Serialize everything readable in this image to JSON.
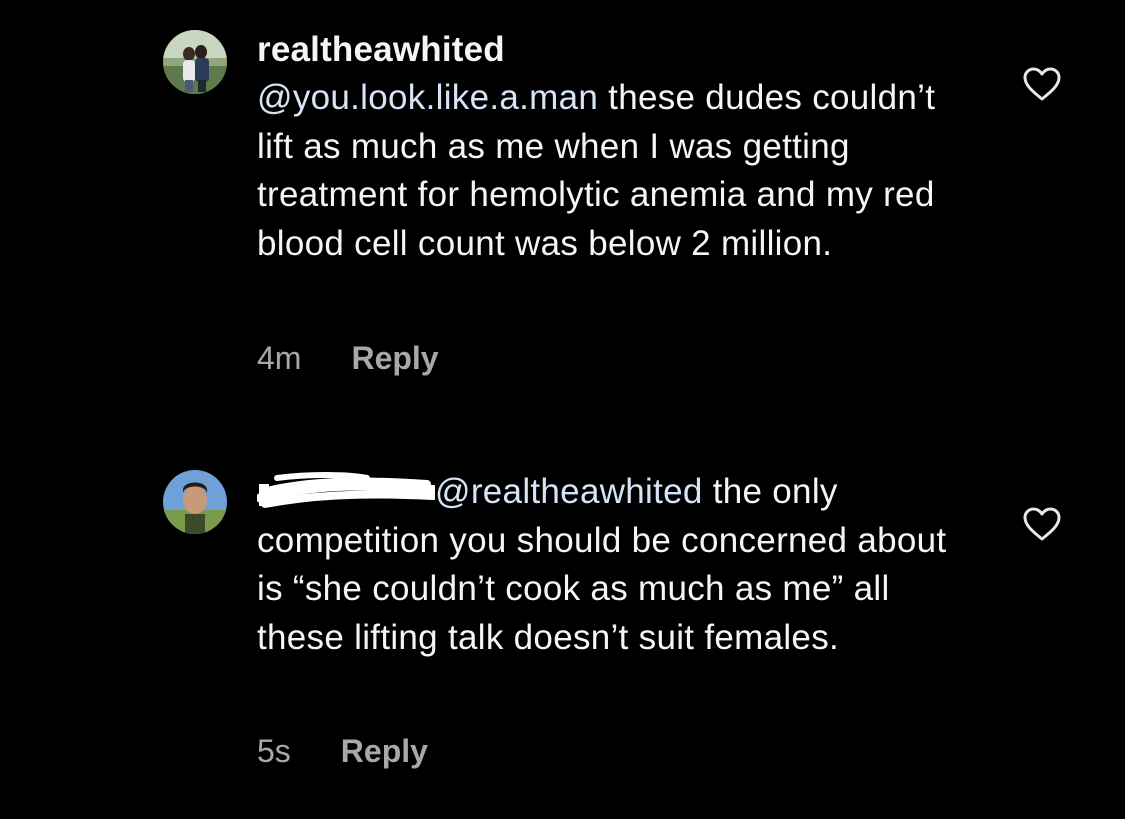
{
  "comments": [
    {
      "username": "realtheawhited",
      "mention": "@you.look.like.a.man",
      "text": " these dudes couldn’t lift as much as me when I was getting treatment for hemolytic anemia and my red blood cell count was below 2 million.",
      "time": "4m",
      "reply_label": "Reply"
    },
    {
      "mention": "@realtheawhited",
      "text": " the only competition you should be concerned about is “she couldn’t cook as much as me” all these lifting talk doesn’t suit females.",
      "time": "5s",
      "reply_label": "Reply"
    }
  ],
  "icons": {
    "like": "heart-outline-icon",
    "redaction": "scribble-redaction"
  },
  "colors": {
    "background": "#000000",
    "text": "#f5f5f5",
    "mention": "#d7e3f7",
    "meta": "#a8a8a8"
  }
}
